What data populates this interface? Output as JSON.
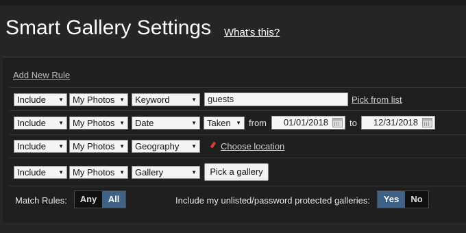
{
  "header": {
    "title": "Smart Gallery Settings",
    "whats_this": "What's this?"
  },
  "add_rule_label": "Add New Rule",
  "rules": [
    {
      "mode": "Include",
      "scope": "My Photos",
      "field": "Keyword",
      "value": "guests",
      "action": "Pick from list"
    },
    {
      "mode": "Include",
      "scope": "My Photos",
      "field": "Date",
      "date_type": "Taken",
      "from_label": "from",
      "from_date": "01/01/2018",
      "to_label": "to",
      "to_date": "12/31/2018"
    },
    {
      "mode": "Include",
      "scope": "My Photos",
      "field": "Geography",
      "action": "Choose location"
    },
    {
      "mode": "Include",
      "scope": "My Photos",
      "field": "Gallery",
      "action": "Pick a gallery"
    }
  ],
  "match_rules": {
    "label": "Match Rules:",
    "options": [
      "Any",
      "All"
    ],
    "selected": "All"
  },
  "include_unlisted": {
    "label": "Include my unlisted/password protected galleries:",
    "options": [
      "Yes",
      "No"
    ],
    "selected": "Yes"
  },
  "colors": {
    "background": "#262626",
    "panel": "#1f1f1f",
    "active_segment": "#3f6289"
  },
  "icons": {
    "location": "map-pin-icon",
    "calendar": "calendar-icon",
    "dropdown": "chevron-down-icon"
  }
}
